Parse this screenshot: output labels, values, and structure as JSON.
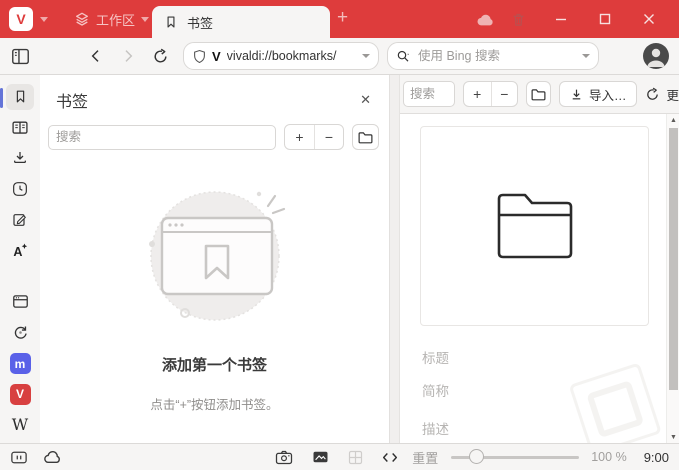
{
  "titlebar": {
    "workspace_label": "工作区",
    "tab_title": "书签",
    "new_tab_glyph": "+"
  },
  "addressbar": {
    "url": "vivaldi://bookmarks/",
    "search_placeholder": "使用 Bing 搜索"
  },
  "icons": {
    "vivaldi_logo_glyph": "V",
    "url_favicon_glyph": "V",
    "mastodon_glyph": "m",
    "vivaldi_panel_glyph": "V",
    "wikipedia_glyph": "W"
  },
  "panel": {
    "title": "书签",
    "close_glyph": "✕",
    "search_placeholder": "搜索",
    "add_glyph": "+",
    "remove_glyph": "−",
    "empty_heading": "添加第一个书签",
    "empty_hint": "点击“+”按钮添加书签。"
  },
  "manager": {
    "search_placeholder": "搜索",
    "add_glyph": "+",
    "remove_glyph": "−",
    "import_label": "导入…",
    "update_label_partial": "更",
    "field_title": "标题",
    "field_nickname": "简称",
    "field_description": "描述"
  },
  "statusbar": {
    "reset_label": "重置",
    "zoom_value": "100 %",
    "clock": "9:00"
  },
  "colors": {
    "accent_red": "#de3c3c",
    "rail_active_indicator": "#6474d8",
    "mastodon_blue": "#5a61e8"
  }
}
